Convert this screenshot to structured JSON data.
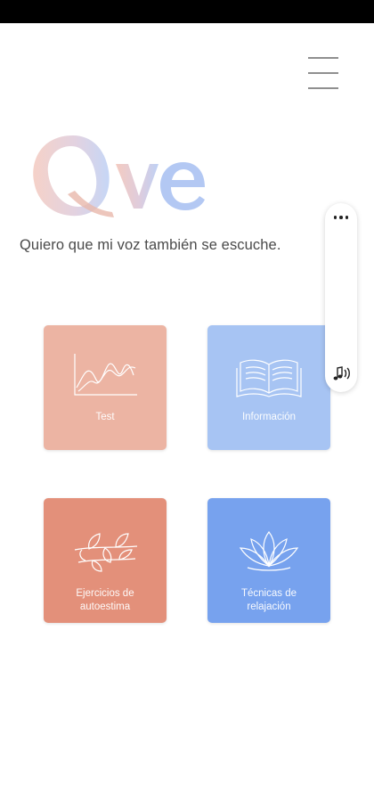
{
  "app": {
    "logo_text": "Qve",
    "tagline": "Quiero que mi voz también se escuche."
  },
  "header": {
    "menu_icon": "hamburger-menu-icon"
  },
  "tiles": [
    {
      "label": "Test",
      "icon": "chart-wave-icon",
      "color": "#ecb4a3"
    },
    {
      "label": "Información",
      "icon": "open-book-icon",
      "color": "#a7c4f3"
    },
    {
      "label": "Ejercicios de autoestima",
      "icon": "leaf-branch-icon",
      "color": "#e3907a"
    },
    {
      "label": "Técnicas de relajación",
      "icon": "lotus-icon",
      "color": "#77a2ee"
    }
  ],
  "floating_panel": {
    "top_icon": "more-horizontal-icon",
    "bottom_icon": "audio-note-icon"
  },
  "colors": {
    "status_bar": "#000000",
    "background": "#ffffff",
    "logo_gradient_start": "#f0b7a8",
    "logo_gradient_end": "#a9c3f2"
  }
}
